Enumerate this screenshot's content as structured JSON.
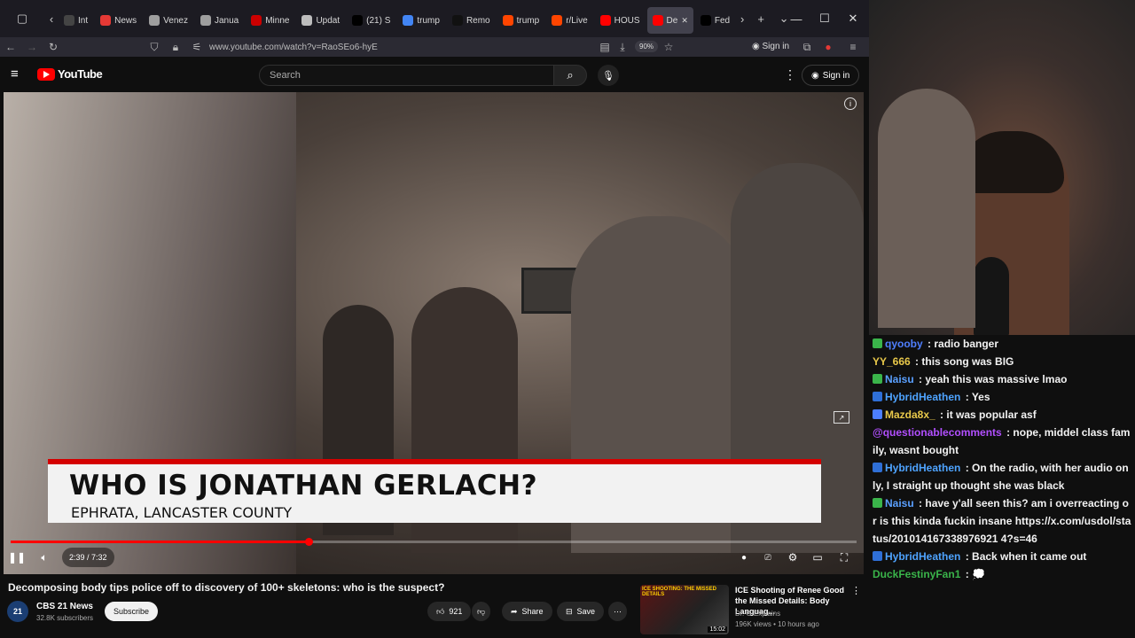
{
  "browser": {
    "tabs": [
      {
        "label": "Int",
        "color": "#444"
      },
      {
        "label": "News",
        "color": "#e53935"
      },
      {
        "label": "Venez",
        "color": "#9e9e9e"
      },
      {
        "label": "Janua",
        "color": "#9e9e9e"
      },
      {
        "label": "Minne",
        "color": "#cc0000"
      },
      {
        "label": "Updat",
        "color": "#bdbdbd"
      },
      {
        "label": "(21) S",
        "color": "#000000"
      },
      {
        "label": "trump",
        "color": "#4285f4"
      },
      {
        "label": "Remo",
        "color": "#111111"
      },
      {
        "label": "trump",
        "color": "#ff4500"
      },
      {
        "label": "r/Live",
        "color": "#ff4500"
      },
      {
        "label": "HOUS",
        "color": "#ff0000"
      },
      {
        "label": "De",
        "color": "#ff0000",
        "active": true
      },
      {
        "label": "Fed",
        "color": "#000000"
      }
    ],
    "url": "www.youtube.com/watch?v=RaoSEo6-hyE",
    "zoom": "90%",
    "sign_in": "Sign in"
  },
  "youtube": {
    "logo": "YouTube",
    "search_placeholder": "Search",
    "sign_in": "Sign in",
    "player": {
      "lower_third_title": "WHO IS JONATHAN GERLACH?",
      "lower_third_sub": "EPHRATA, LANCASTER COUNTY",
      "time": "2:39 / 7:32",
      "progress": 0.352
    },
    "video": {
      "title": "Decomposing body tips police off to discovery of 100+ skeletons: who is the suspect?",
      "channel": "CBS 21 News",
      "channel_avatar": "21",
      "subscribers": "32.8K subscribers",
      "subscribe": "Subscribe",
      "likes": "921",
      "share": "Share",
      "save": "Save"
    },
    "recommended": {
      "title": "ICE Shooting of Renee Good the Missed Details: Body Languag...",
      "channel": "Dr. G Explains",
      "meta": "196K views • 10 hours ago",
      "thumb_caption": "ICE SHOOTING: THE MISSED DETAILS",
      "duration": "15:02"
    }
  },
  "chat": {
    "messages": [
      {
        "user": "qyooby",
        "text": "radio banger",
        "color": "#4f7fff",
        "badge": "#3ab44a"
      },
      {
        "user": "YY_666",
        "text": "this song was BIG",
        "color": "#e8c84a",
        "badge": ""
      },
      {
        "user": "Naisu",
        "text": "yeah this was massive lmao",
        "color": "#5aa0ff",
        "badge": "#3ab44a"
      },
      {
        "user": "HybridHeathen",
        "text": "Yes",
        "color": "#4ea3ff",
        "badge": "#2f6fd6"
      },
      {
        "user": "Mazda8x_",
        "text": "it was popular asf",
        "color": "#e8c84a",
        "badge": "#4c7fff"
      },
      {
        "user": "@questionablecomments",
        "text": "nope, middel class family, wasnt bought",
        "color": "#b24fff",
        "badge": ""
      },
      {
        "user": "HybridHeathen",
        "text": "On the radio, with her audio only, I straight up thought she was black",
        "color": "#4ea3ff",
        "badge": "#2f6fd6"
      },
      {
        "user": "Naisu",
        "text": "have y'all seen this? am i overreacting or is this kinda fuckin insane https://x.com/usdol/status/201014167338976921 4?s=46",
        "color": "#5aa0ff",
        "badge": "#3ab44a"
      },
      {
        "user": "HybridHeathen",
        "text": "Back when it came out",
        "color": "#4ea3ff",
        "badge": "#2f6fd6"
      },
      {
        "user": "DuckFestinyFan1",
        "text": "💭",
        "color": "#3ab44a",
        "badge": ""
      }
    ]
  }
}
